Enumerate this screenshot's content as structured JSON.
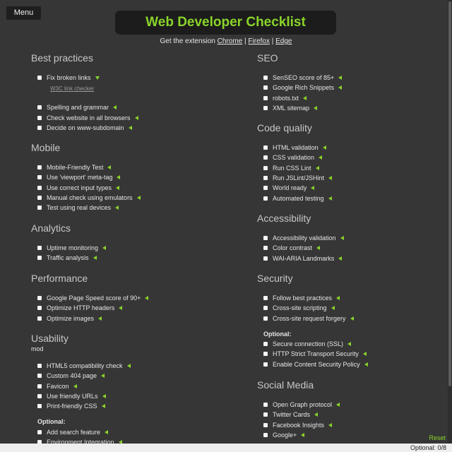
{
  "menu_label": "Menu",
  "title": "Web Developer Checklist",
  "extension": {
    "prefix": "Get the extension",
    "chrome": "Chrome",
    "firefox": "Firefox",
    "edge": "Edge",
    "sep": "|"
  },
  "left": {
    "best_practices": {
      "title": "Best practices",
      "items": [
        {
          "label": "Fix broken links",
          "arrow": "down"
        },
        {
          "label": "Spelling and grammar"
        },
        {
          "label": "Check website in all browsers"
        },
        {
          "label": "Decide on www-subdomain"
        }
      ],
      "sublink": "W3C link checker"
    },
    "mobile": {
      "title": "Mobile",
      "items": [
        {
          "label": "Mobile-Friendly Test"
        },
        {
          "label": "Use 'viewport' meta-tag"
        },
        {
          "label": "Use correct input types"
        },
        {
          "label": "Manual check using emulators"
        },
        {
          "label": "Test using real devices"
        }
      ]
    },
    "analytics": {
      "title": "Analytics",
      "items": [
        {
          "label": "Uptime monitoring"
        },
        {
          "label": "Traffic analysis"
        }
      ]
    },
    "performance": {
      "title": "Performance",
      "items": [
        {
          "label": "Google Page Speed score of 90+"
        },
        {
          "label": "Optimize HTTP headers"
        },
        {
          "label": "Optimize images"
        }
      ]
    },
    "usability": {
      "title": "Usability",
      "subtitle": "mod",
      "items": [
        {
          "label": "HTML5 compatibility check"
        },
        {
          "label": "Custom 404 page"
        },
        {
          "label": "Favicon"
        },
        {
          "label": "Use friendly URLs"
        },
        {
          "label": "Print-friendly CSS"
        }
      ],
      "optional_label": "Optional:",
      "optional_items": [
        {
          "label": "Add search feature"
        },
        {
          "label": "Environment Integration"
        }
      ]
    }
  },
  "right": {
    "seo": {
      "title": "SEO",
      "items": [
        {
          "label": "SenSEO score of 85+"
        },
        {
          "label": "Google Rich Snippets"
        },
        {
          "label": "robots.txt"
        },
        {
          "label": "XML sitemap"
        }
      ]
    },
    "code_quality": {
      "title": "Code quality",
      "items": [
        {
          "label": "HTML validation"
        },
        {
          "label": "CSS validation"
        },
        {
          "label": "Run CSS Lint"
        },
        {
          "label": "Run JSLint/JSHint"
        },
        {
          "label": "World ready"
        },
        {
          "label": "Automated testing"
        }
      ]
    },
    "accessibility": {
      "title": "Accessibility",
      "items": [
        {
          "label": "Accessibility validation"
        },
        {
          "label": "Color contrast"
        },
        {
          "label": "WAI-ARIA Landmarks"
        }
      ]
    },
    "security": {
      "title": "Security",
      "items": [
        {
          "label": "Follow best practices"
        },
        {
          "label": "Cross-site scripting"
        },
        {
          "label": "Cross-site request forgery"
        }
      ],
      "optional_label": "Optional:",
      "optional_items": [
        {
          "label": "Secure connection (SSL)"
        },
        {
          "label": "HTTP Strict Transport Security"
        },
        {
          "label": "Enable Content Security Policy"
        }
      ]
    },
    "social_media": {
      "title": "Social Media",
      "items": [
        {
          "label": "Open Graph protocol"
        },
        {
          "label": "Twitter Cards"
        },
        {
          "label": "Facebook Insights"
        },
        {
          "label": "Google+"
        }
      ]
    }
  },
  "reset_label": "Reset",
  "status_text": "Optional: 0/8",
  "colors": {
    "accent": "#8ad42a",
    "background": "#363636",
    "title_box": "#1c1c1c"
  },
  "icons": {
    "expand": "triangle-left-icon",
    "expanded": "triangle-down-icon"
  }
}
